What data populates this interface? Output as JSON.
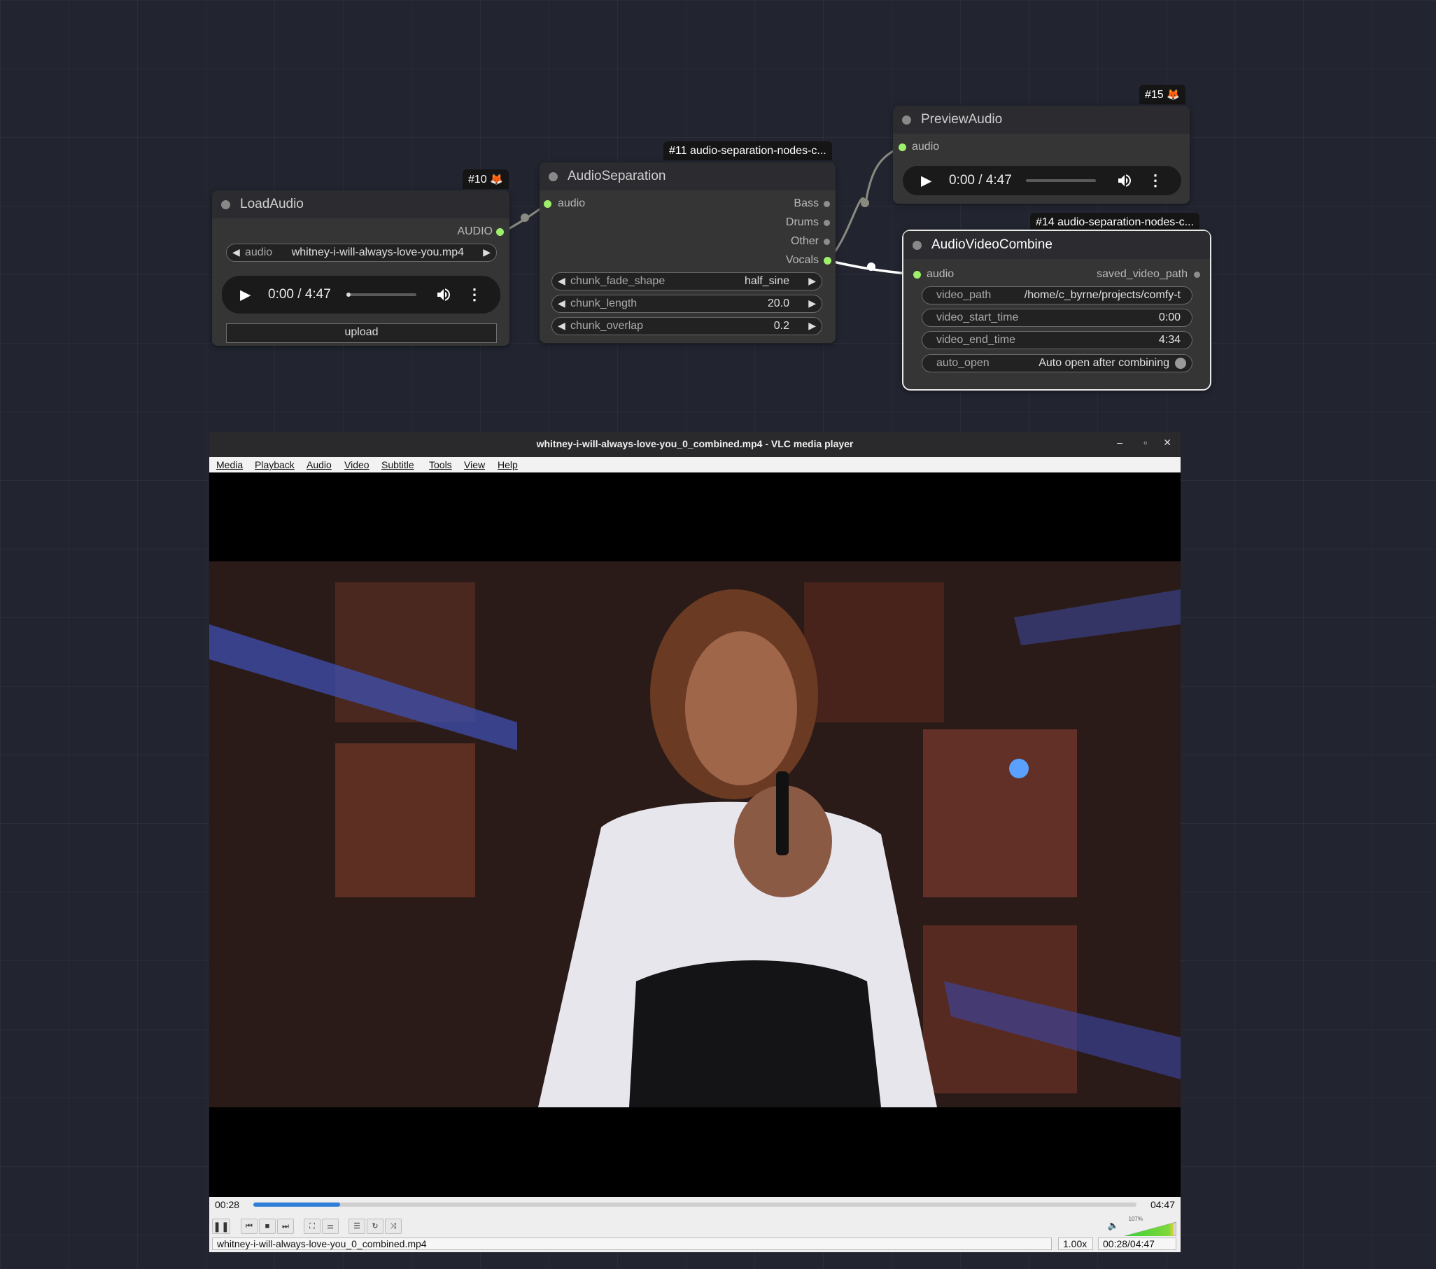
{
  "nodes": {
    "load_audio": {
      "badge": "#10",
      "title": "LoadAudio",
      "output": "AUDIO",
      "audio_widget": {
        "label": "audio",
        "value": "whitney-i-will-always-love-you.mp4"
      },
      "player": {
        "time": "0:00 / 4:47"
      },
      "upload_label": "upload"
    },
    "audio_separation": {
      "badge": "#11 audio-separation-nodes-c...",
      "title": "AudioSeparation",
      "input": "audio",
      "outputs": [
        "Bass",
        "Drums",
        "Other",
        "Vocals"
      ],
      "widgets": [
        {
          "label": "chunk_fade_shape",
          "value": "half_sine"
        },
        {
          "label": "chunk_length",
          "value": "20.0"
        },
        {
          "label": "chunk_overlap",
          "value": "0.2"
        }
      ]
    },
    "preview_audio": {
      "badge": "#15",
      "title": "PreviewAudio",
      "input": "audio",
      "player": {
        "time": "0:00 / 4:47"
      }
    },
    "audio_video_combine": {
      "badge": "#14 audio-separation-nodes-c...",
      "title": "AudioVideoCombine",
      "input": "audio",
      "output": "saved_video_path",
      "widgets": [
        {
          "label": "video_path",
          "value": "/home/c_byrne/projects/comfy-t"
        },
        {
          "label": "video_start_time",
          "value": "0:00"
        },
        {
          "label": "video_end_time",
          "value": "4:34"
        },
        {
          "label": "auto_open",
          "value": "Auto open after combining"
        }
      ]
    }
  },
  "vlc": {
    "title": "whitney-i-will-always-love-you_0_combined.mp4 - VLC media player",
    "window_buttons": [
      "–",
      "▫",
      "✕"
    ],
    "menu": [
      "Media",
      "Playback",
      "Audio",
      "Video",
      "Subtitle",
      "Tools",
      "View",
      "Help"
    ],
    "elapsed": "00:28",
    "total": "04:47",
    "progress": 0.098,
    "volume_label": "107%",
    "status": {
      "filename": "whitney-i-will-always-love-you_0_combined.mp4",
      "speed": "1.00x",
      "time": "00:28/04:47"
    }
  },
  "colors": {
    "slot_connected": "#9ef06a",
    "canvas_bg": "#222530",
    "progress_blue": "#2f7fd8"
  }
}
